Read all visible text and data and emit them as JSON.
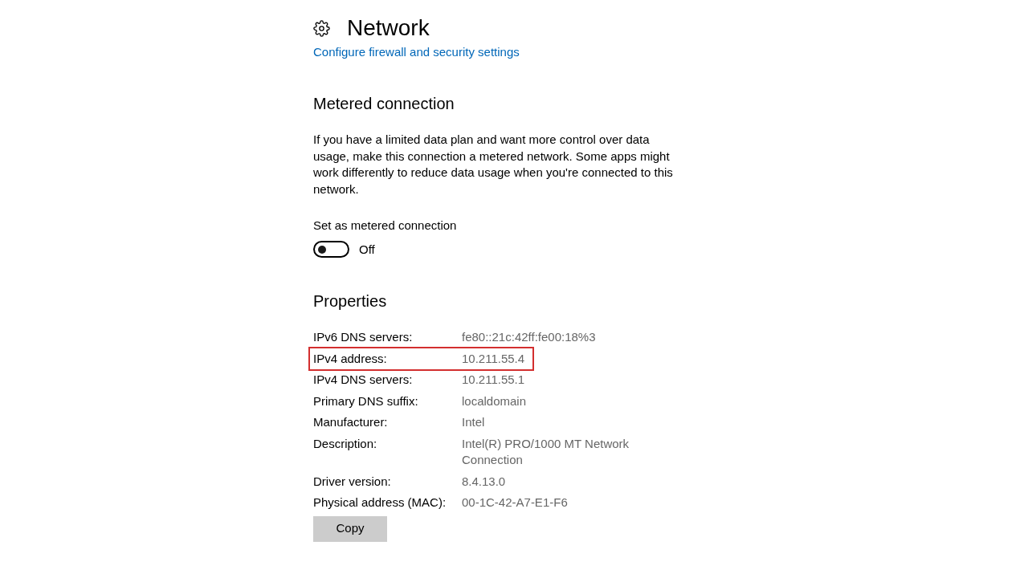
{
  "header": {
    "title": "Network",
    "link": "Configure firewall and security settings"
  },
  "metered_connection": {
    "heading": "Metered connection",
    "description": "If you have a limited data plan and want more control over data usage, make this connection a metered network. Some apps might work differently to reduce data usage when you're connected to this network.",
    "toggle": {
      "label": "Set as metered connection",
      "on": false,
      "state_text": "Off"
    }
  },
  "properties": {
    "heading": "Properties",
    "rows": [
      {
        "label": "IPv6 DNS servers:",
        "value": "fe80::21c:42ff:fe00:18%3",
        "highlighted": false
      },
      {
        "label": "IPv4 address:",
        "value": "10.211.55.4",
        "highlighted": true
      },
      {
        "label": "IPv4 DNS servers:",
        "value": "10.211.55.1",
        "highlighted": false
      },
      {
        "label": "Primary DNS suffix:",
        "value": "localdomain",
        "highlighted": false
      },
      {
        "label": "Manufacturer:",
        "value": "Intel",
        "highlighted": false
      },
      {
        "label": "Description:",
        "value": "Intel(R) PRO/1000 MT Network Connection",
        "highlighted": false
      },
      {
        "label": "Driver version:",
        "value": "8.4.13.0",
        "highlighted": false
      },
      {
        "label": "Physical address (MAC):",
        "value": "00-1C-42-A7-E1-F6",
        "highlighted": false
      }
    ],
    "button": "Copy"
  }
}
